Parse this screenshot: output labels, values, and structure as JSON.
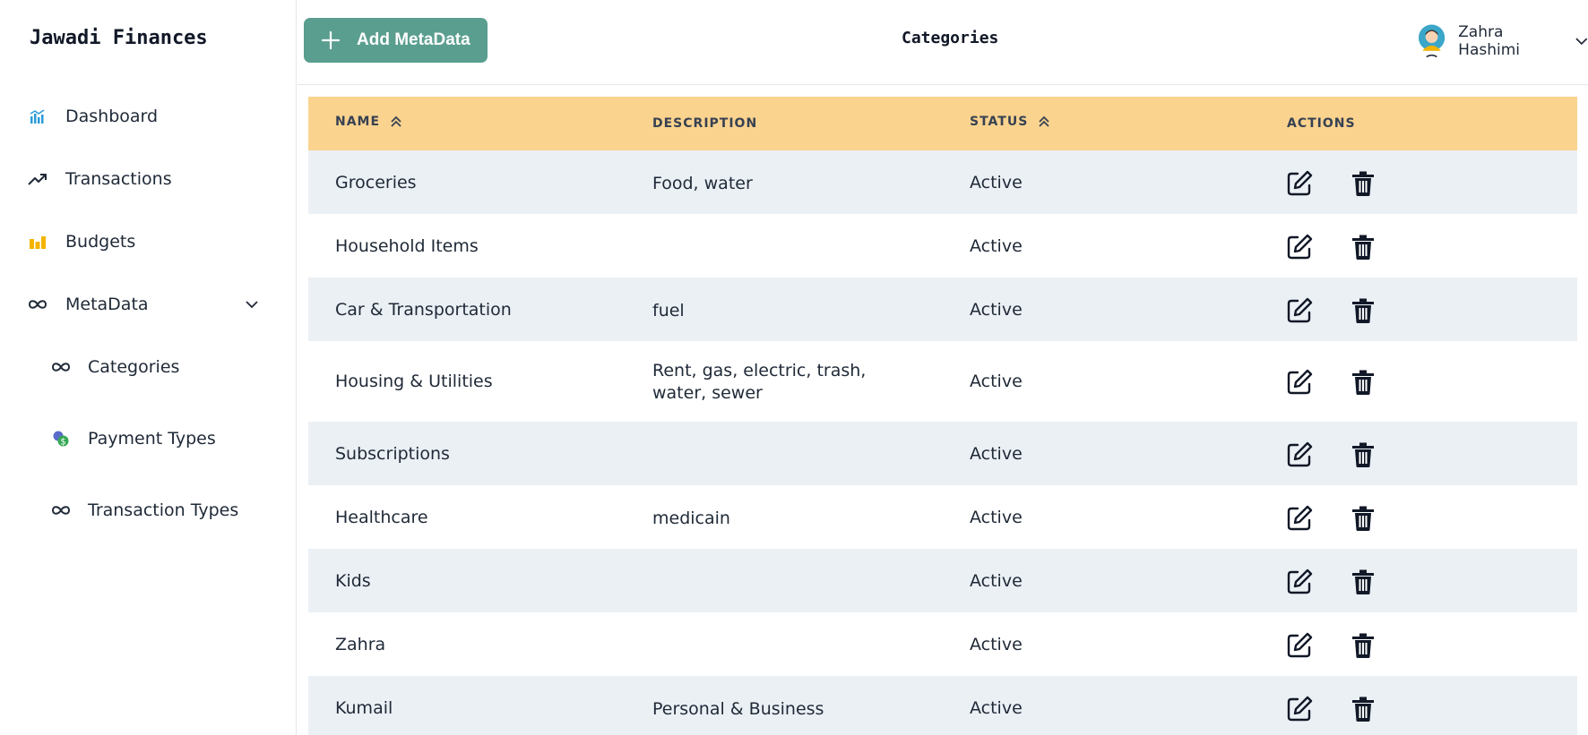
{
  "sidebar": {
    "brand": "Jawadi Finances",
    "items": [
      {
        "label": "Dashboard",
        "icon": "chart-bars-icon"
      },
      {
        "label": "Transactions",
        "icon": "trending-up-icon"
      },
      {
        "label": "Budgets",
        "icon": "budget-bars-icon"
      },
      {
        "label": "MetaData",
        "icon": "infinity-icon"
      }
    ],
    "sub_items": [
      {
        "label": "Categories",
        "icon": "infinity-icon"
      },
      {
        "label": "Payment Types",
        "icon": "payment-coins-icon"
      },
      {
        "label": "Transaction Types",
        "icon": "infinity-icon"
      }
    ]
  },
  "header": {
    "add_label": "Add MetaData",
    "title": "Categories",
    "user_name": "Zahra Hashimi"
  },
  "table": {
    "columns": [
      "NAME",
      "DESCRIPTION",
      "STATUS",
      "ACTIONS"
    ],
    "rows": [
      {
        "name": "Groceries",
        "description": "Food, water",
        "status": "Active"
      },
      {
        "name": "Household Items",
        "description": "",
        "status": "Active"
      },
      {
        "name": "Car & Transportation",
        "description": "fuel",
        "status": "Active"
      },
      {
        "name": "Housing & Utilities",
        "description": "Rent, gas, electric, trash, water, sewer",
        "status": "Active"
      },
      {
        "name": "Subscriptions",
        "description": "",
        "status": "Active"
      },
      {
        "name": "Healthcare",
        "description": "medicain",
        "status": "Active"
      },
      {
        "name": "Kids",
        "description": "",
        "status": "Active"
      },
      {
        "name": "Zahra",
        "description": "",
        "status": "Active"
      },
      {
        "name": "Kumail",
        "description": "Personal & Business",
        "status": "Active"
      }
    ]
  },
  "colors": {
    "accent": "#5a9e8f",
    "table_header": "#fad38f",
    "row_alt": "#ebf0f5"
  }
}
